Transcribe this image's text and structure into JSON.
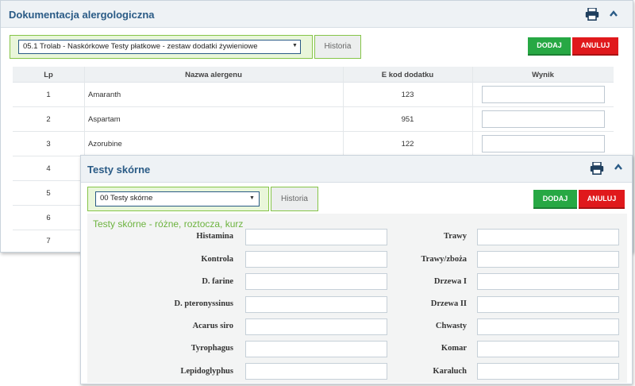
{
  "panel1": {
    "title": "Dokumentacja alergologiczna",
    "select_value": "05.1 Trolab - Naskórkowe Testy płatkowe - zestaw dodatki żywieniowe",
    "history_tab": "Historia",
    "add_label": "DODAJ",
    "cancel_label": "ANULUJ",
    "columns": [
      "Lp",
      "Nazwa alergenu",
      "E kod dodatku",
      "Wynik"
    ],
    "rows": [
      {
        "lp": "1",
        "name": "Amaranth",
        "ecode": "123",
        "result": ""
      },
      {
        "lp": "2",
        "name": "Aspartam",
        "ecode": "951",
        "result": ""
      },
      {
        "lp": "3",
        "name": "Azorubine",
        "ecode": "122",
        "result": ""
      },
      {
        "lp": "4",
        "name": "",
        "ecode": "",
        "result": ""
      },
      {
        "lp": "5",
        "name": "",
        "ecode": "",
        "result": ""
      },
      {
        "lp": "6",
        "name": "",
        "ecode": "",
        "result": ""
      },
      {
        "lp": "7",
        "name": "",
        "ecode": "",
        "result": ""
      }
    ]
  },
  "panel2": {
    "title": "Testy skórne",
    "select_value": "00 Testy skórne",
    "history_tab": "Historia",
    "add_label": "DODAJ",
    "cancel_label": "ANULUJ",
    "section_title": "Testy skórne - różne, roztocza, kurz",
    "left_fields": [
      "Histamina",
      "Kontrola",
      "D. farine",
      "D. pteronyssinus",
      "Acarus siro",
      "Tyrophagus",
      "Lepidoglyphus"
    ],
    "right_fields": [
      "Trawy",
      "Trawy/zboża",
      "Drzewa I",
      "Drzewa II",
      "Chwasty",
      "Komar",
      "Karaluch"
    ]
  },
  "icons": {
    "print": "printer-icon",
    "collapse": "chevron-up-icon",
    "dropdown": "caret-down-icon"
  },
  "colors": {
    "title_blue": "#2a5b86",
    "accent_green": "#86c548",
    "section_green": "#6db33f",
    "add_green": "#27a844",
    "cancel_red": "#e0191c"
  }
}
